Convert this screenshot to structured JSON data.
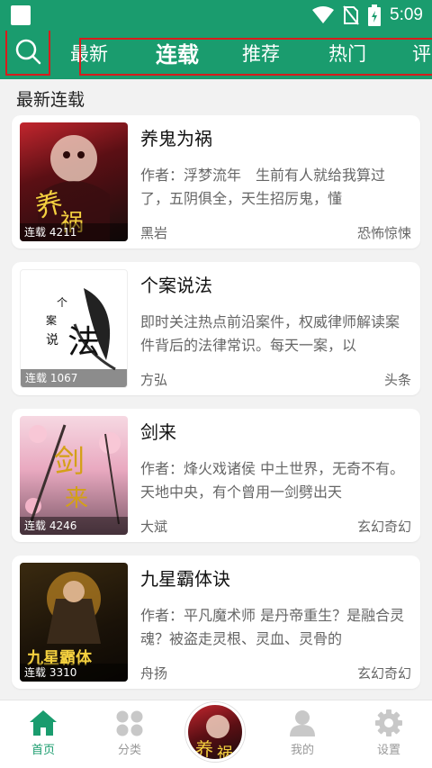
{
  "status_bar": {
    "time": "5:09"
  },
  "topnav": {
    "tabs": [
      "最新",
      "连载",
      "推荐",
      "热门",
      "评"
    ],
    "active_tab": "连载",
    "accent_color": "#1a9c6e"
  },
  "section_title": "最新连载",
  "books": [
    {
      "title": "养鬼为祸",
      "desc": "作者：浮梦流年　生前有人就给我算过了，五阴俱全，天生招厉鬼，懂",
      "author": "黑岩",
      "category": "恐怖惊悚",
      "badge": "连载 4211",
      "cover_text": "养鬼为祸"
    },
    {
      "title": "个案说法",
      "desc": "即时关注热点前沿案件，权威律师解读案件背后的法律常识。每天一案，以",
      "author": "方弘",
      "category": "头条",
      "badge": "连载 1067",
      "cover_text": "个案说法"
    },
    {
      "title": "剑来",
      "desc": "作者：烽火戏诸侯 中土世界，无奇不有。天地中央，有个曾用一剑劈出天",
      "author": "大斌",
      "category": "玄幻奇幻",
      "badge": "连载 4246",
      "cover_text": "剑来"
    },
    {
      "title": "九星霸体诀",
      "desc": "作者：平凡魔术师 是丹帝重生？是融合灵魂？被盗走灵根、灵血、灵骨的",
      "author": "舟扬",
      "category": "玄幻奇幻",
      "badge": "连载 3310",
      "cover_text": "九星霸体诀"
    }
  ],
  "bottomnav": {
    "items": [
      {
        "label": "首页",
        "icon": "home-icon"
      },
      {
        "label": "分类",
        "icon": "category-icon"
      },
      {
        "label": "我的",
        "icon": "profile-icon"
      },
      {
        "label": "设置",
        "icon": "settings-icon"
      }
    ]
  }
}
